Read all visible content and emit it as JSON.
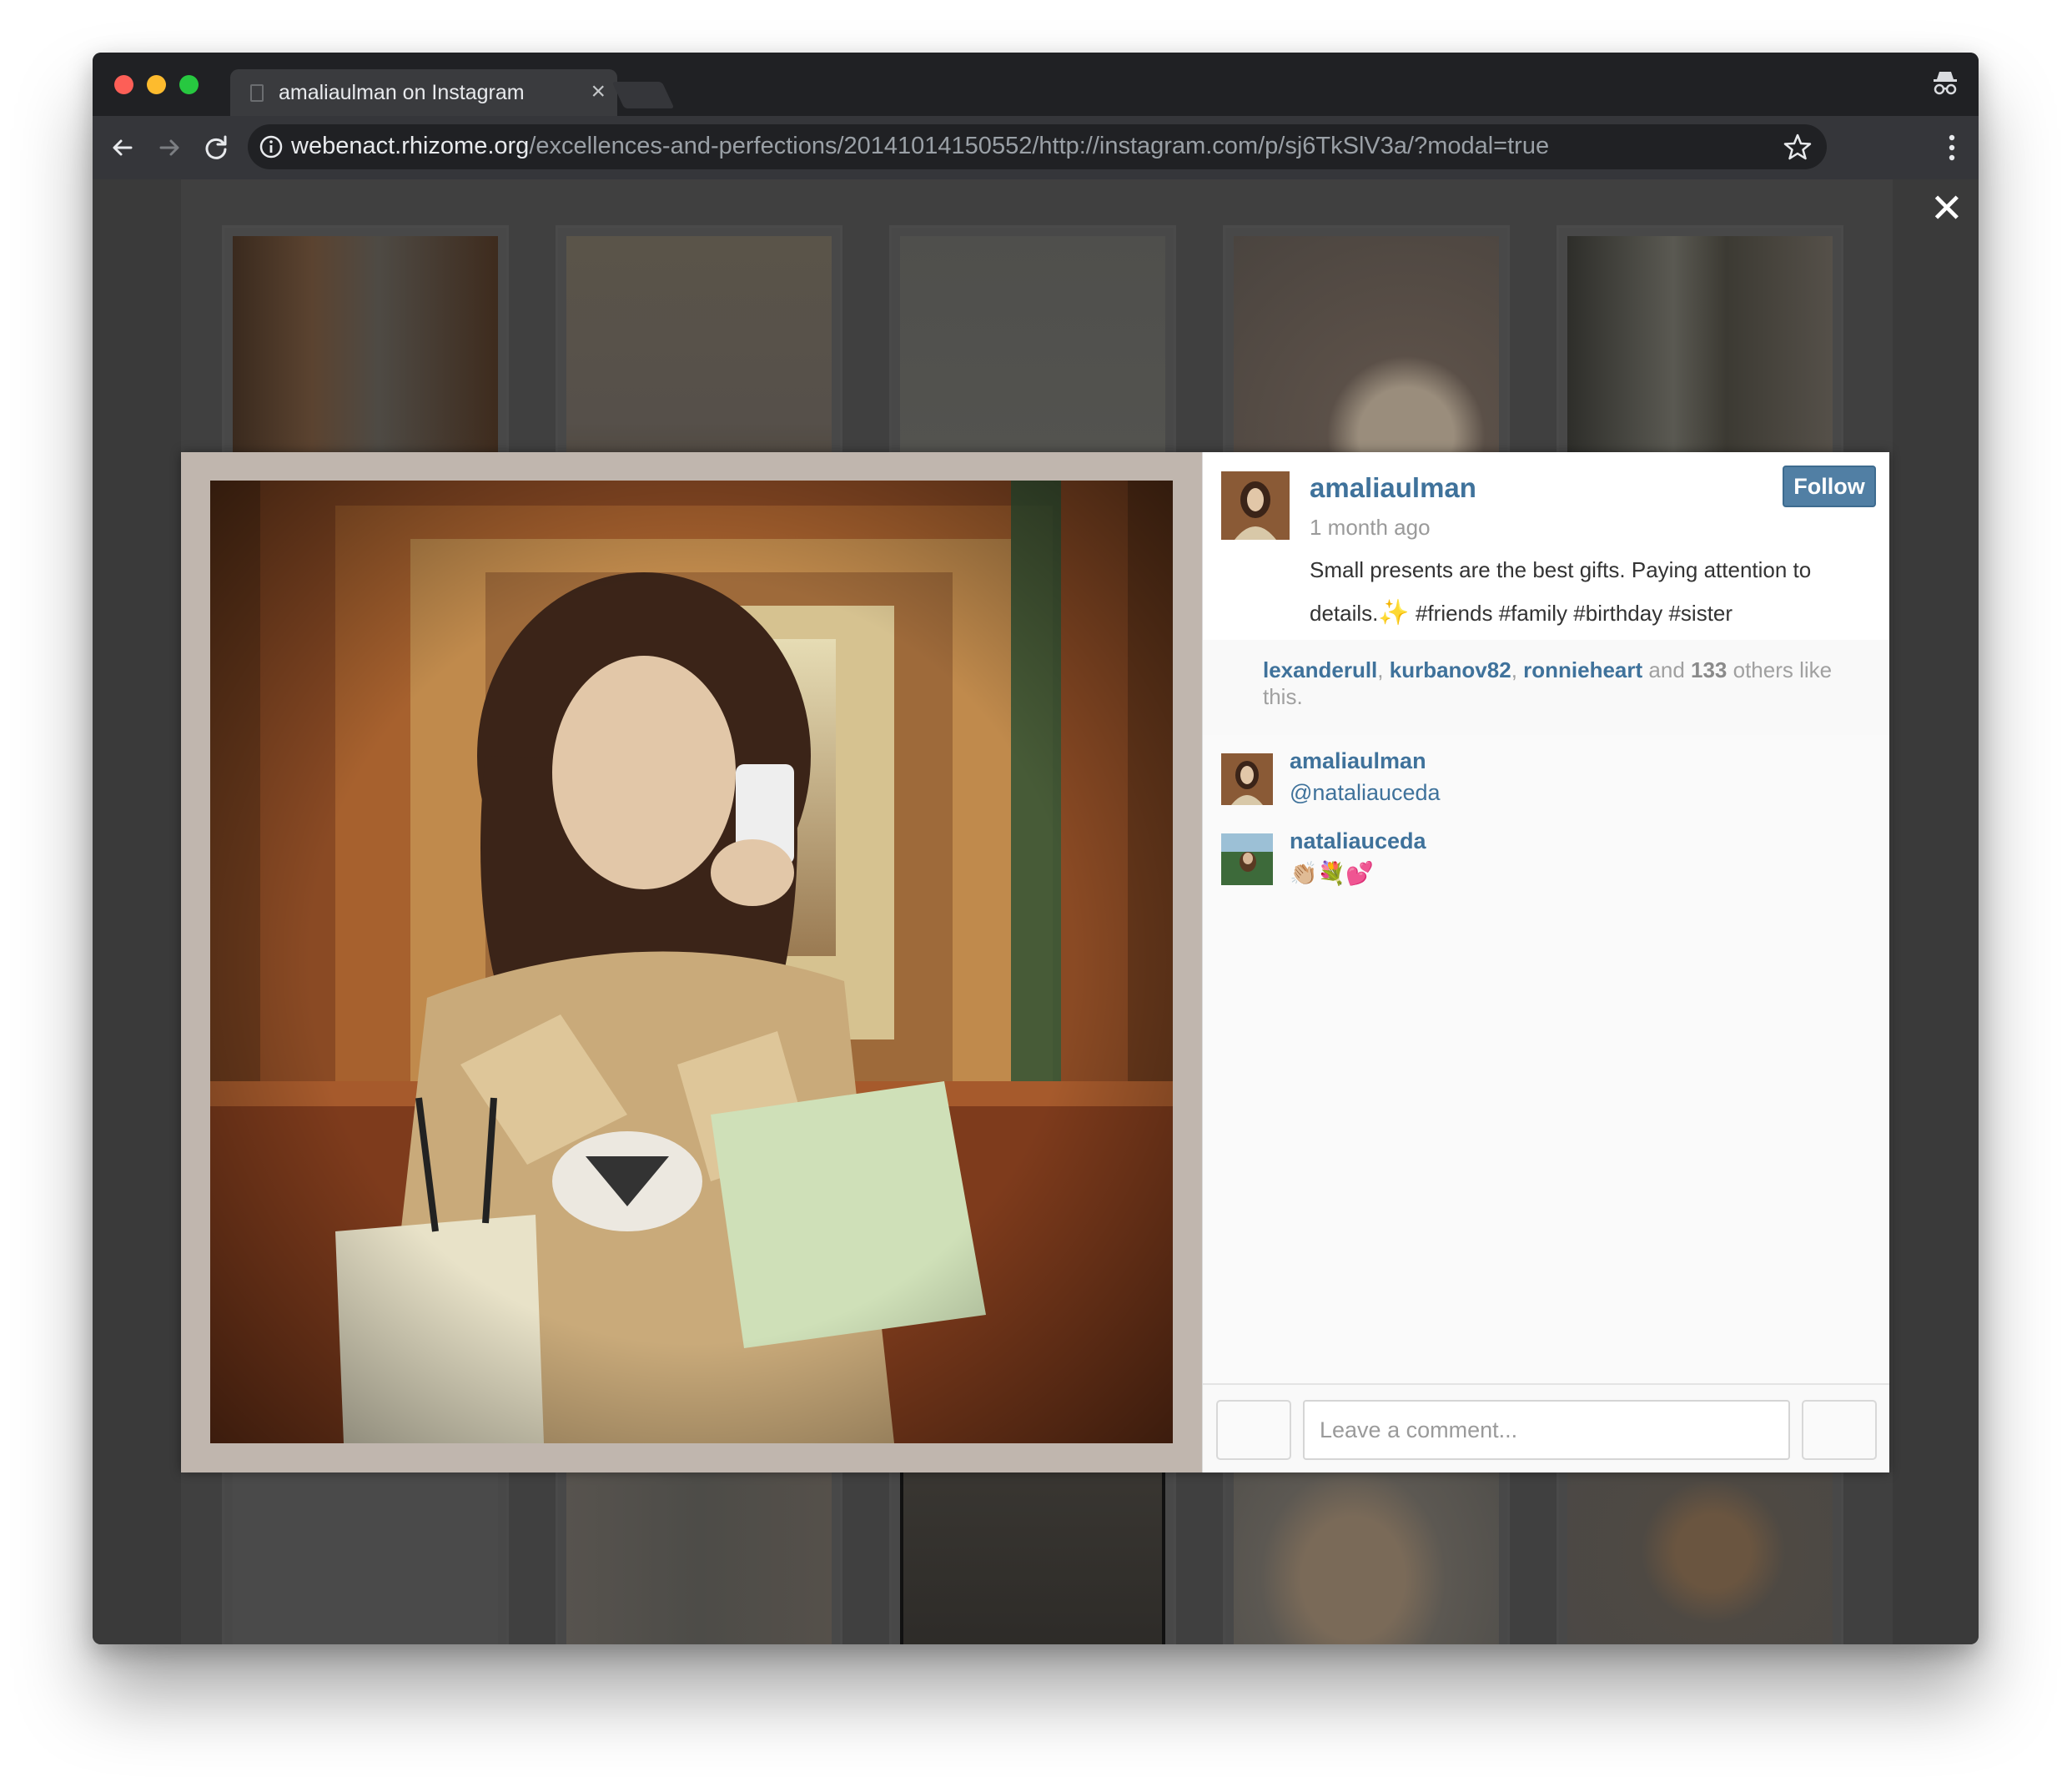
{
  "browser": {
    "tab_title": "amaliaulman on Instagram",
    "url_host": "webenact.rhizome.org",
    "url_path": "/excellences-and-perfections/20141014150552/http://instagram.com/p/sj6TkSlV3a/?modal=true"
  },
  "modal": {
    "close_symbol": "✕"
  },
  "post": {
    "author": "amaliaulman",
    "follow_label": "Follow",
    "time_ago": "1 month ago",
    "caption_before": "Small presents are the best gifts. Paying attention to details.",
    "caption_emoji": "✨",
    "caption_tags": " #friends #family #birthday #sister"
  },
  "likes": {
    "user1": "lexanderull",
    "user2": "kurbanov82",
    "user3": "ronnieheart",
    "and_text": " and ",
    "count": "133",
    "suffix": " others like this."
  },
  "comments": [
    {
      "user": "amaliaulman",
      "text": "@nataliauceda"
    },
    {
      "user": "nataliauceda",
      "text": "👏🏼💐💕"
    }
  ],
  "comment_box": {
    "placeholder": "Leave a comment..."
  },
  "colors": {
    "link_blue": "#3f729b",
    "follow_button": "#517fa4",
    "overlay": "#404040"
  }
}
